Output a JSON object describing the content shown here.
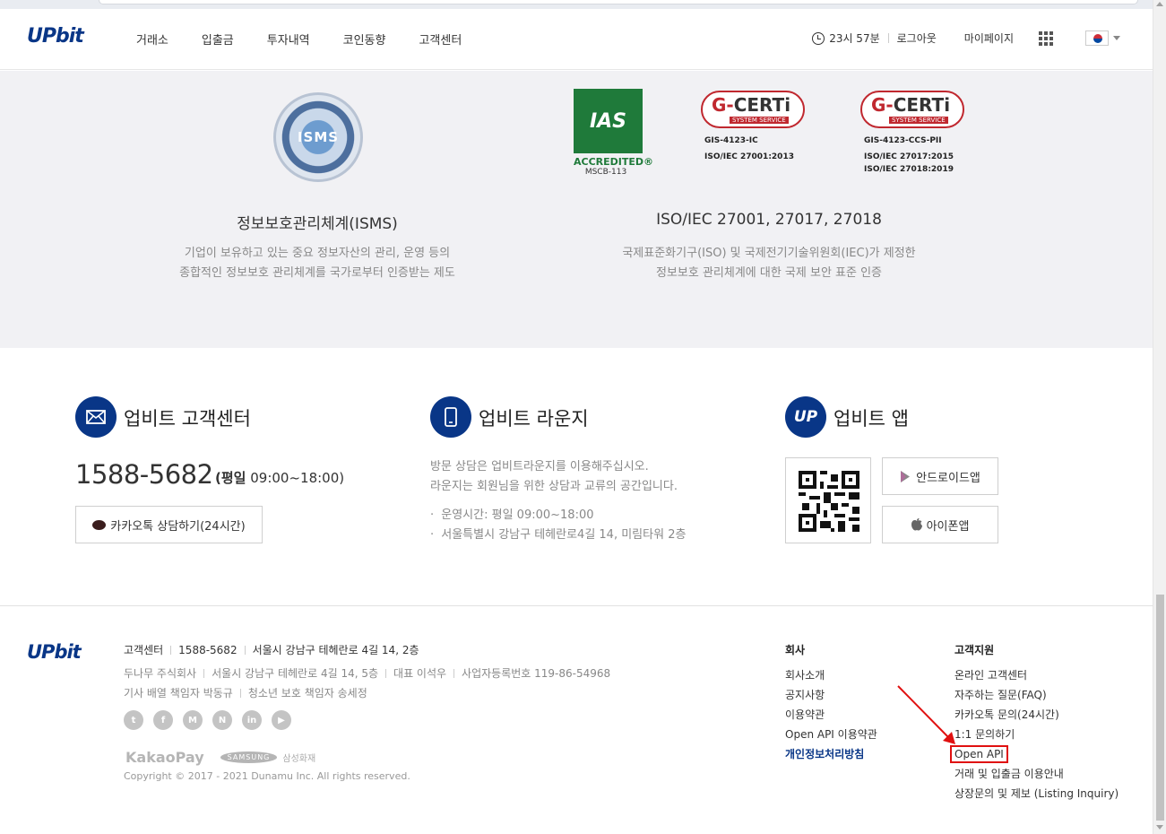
{
  "header": {
    "logo": "UPbit",
    "nav": [
      "거래소",
      "입출금",
      "투자내역",
      "코인동향",
      "고객센터"
    ],
    "time": "23시 57분",
    "logout": "로그아웃",
    "mypage": "마이페이지"
  },
  "certifications": {
    "isms_badge_text": "ISMS",
    "ias_logo_text": "IAS",
    "ias_accredited": "ACCREDITED®",
    "ias_code": "MSCB-113",
    "gcert1": {
      "brand_g": "G-",
      "brand": "CERTi",
      "sub": "SYSTEM SERVICE",
      "lines": [
        "GIS-4123-IC",
        "ISO/IEC 27001:2013"
      ]
    },
    "gcert2": {
      "brand_g": "G-",
      "brand": "CERTi",
      "sub": "SYSTEM SERVICE",
      "lines": [
        "GIS-4123-CCS-PII",
        "ISO/IEC 27017:2015",
        "ISO/IEC 27018:2019"
      ]
    },
    "isms_title": "정보보호관리체계(ISMS)",
    "isms_desc": [
      "기업이 보유하고 있는 중요 정보자산의 관리, 운영 등의",
      "종합적인 정보보호 관리체계를 국가로부터 인증받는 제도"
    ],
    "iso_title": "ISO/IEC 27001, 27017, 27018",
    "iso_desc": [
      "국제표준화기구(ISO) 및 국제전기기술위원회(IEC)가 제정한",
      "정보보호 관리체계에 대한 국제 보안 표준 인증"
    ]
  },
  "contact": {
    "center_title": "업비트 고객센터",
    "phone": "1588-5682",
    "phone_hours_prefix": "(평일",
    "phone_hours": "09:00~18:00)",
    "kakao_button": "카카오톡 상담하기(24시간)",
    "lounge_title": "업비트 라운지",
    "lounge_desc": [
      "방문 상담은 업비트라운지를 이용해주십시오.",
      "라운지는 회원님을 위한 상담과 교류의 공간입니다."
    ],
    "lounge_items": [
      "운영시간: 평일 09:00~18:00",
      "서울특별시 강남구 테헤란로4길 14, 미림타워 2층"
    ],
    "app_title": "업비트 앱",
    "app_icon_text": "UP",
    "android_button": "안드로이드앱",
    "iphone_button": "아이폰앱"
  },
  "footer": {
    "logo": "UPbit",
    "line1": [
      "고객센터",
      "1588-5682",
      "서울시 강남구 테헤란로 4길 14, 2층"
    ],
    "line2": [
      "두나무 주식회사",
      "서울시 강남구 테헤란로 4길 14, 5층",
      "대표 이석우",
      "사업자등록번호 119-86-54968"
    ],
    "line3": [
      "기사 배열 책임자 박동규",
      "청소년 보호 책임자 송세정"
    ],
    "social": [
      "t",
      "f",
      "M",
      "N",
      "in",
      "▶"
    ],
    "kakaopay": "KakaoPay",
    "samsung": "SAMSUNG",
    "samsung_fire": "삼성화재",
    "copyright": "Copyright © 2017 - 2021 Dunamu Inc. All rights reserved.",
    "company_head": "회사",
    "company_items": [
      "회사소개",
      "공지사항",
      "이용약관",
      "Open API 이용약관",
      "개인정보처리방침"
    ],
    "support_head": "고객지원",
    "support_items": [
      "온라인 고객센터",
      "자주하는 질문(FAQ)",
      "카카오톡 문의(24시간)",
      "1:1 문의하기",
      "Open API",
      "거래 및 입출금 이용안내",
      "상장문의 및 제보 (Listing Inquiry)"
    ]
  },
  "colors": {
    "brand": "#093687",
    "highlight": "#e01010",
    "cert_bg": "#f1f1f4"
  }
}
